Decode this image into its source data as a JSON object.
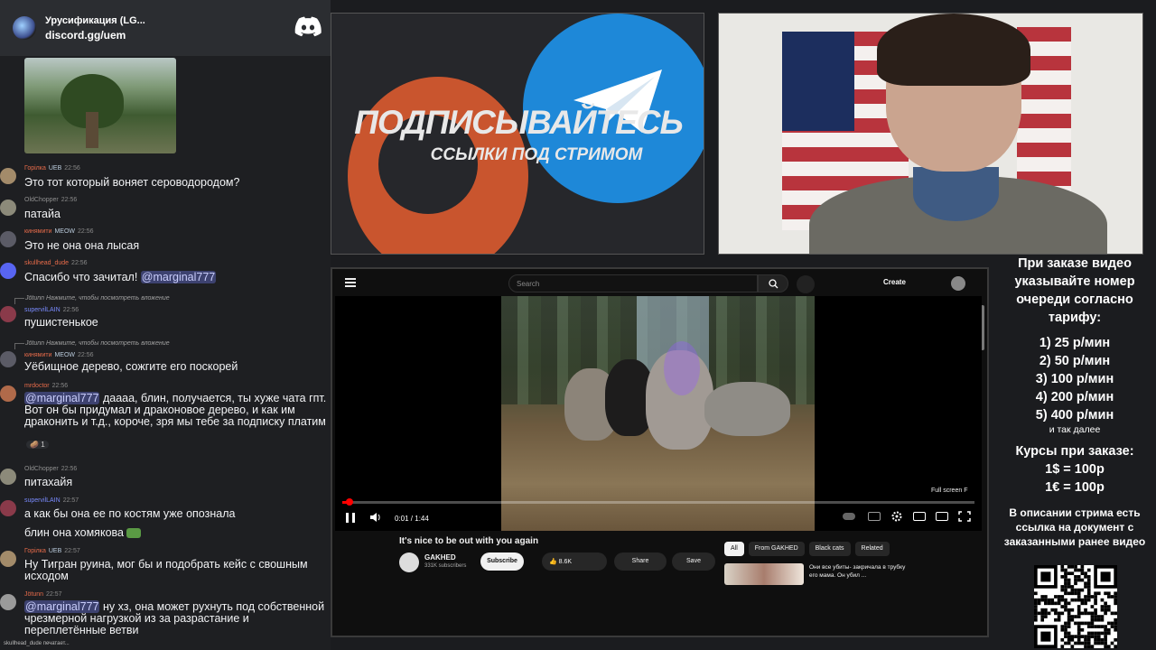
{
  "chat": {
    "server_name": "Урусификация (LG...",
    "server_link": "discord.gg/uem",
    "messages": [
      {
        "user": "Горілка",
        "tag": "UEB",
        "time": "22:56",
        "text": "Это тот который воняет сероводородом?"
      },
      {
        "user": "OldChopper",
        "time": "22:56",
        "text": "патайа"
      },
      {
        "user": "кинямити",
        "tag": "MEOW",
        "time": "22:56",
        "text": "Это не она она лысая"
      },
      {
        "user": "skullhead_dude",
        "time": "22:56",
        "text": "Спасибо что зачитал! ",
        "mention": "@marginal777"
      },
      {
        "reply": "Jötunn Нажмите, чтобы посмотреть вложение",
        "user": "supervilLAIN",
        "time": "22:56",
        "text": "пушистенькое"
      },
      {
        "reply": "Jötunn Нажмите, чтобы посмотреть вложение",
        "user": "кинямити",
        "tag": "MEOW",
        "time": "22:56",
        "text": "Уёбищное дерево, сожгите его поскорей"
      },
      {
        "user": "mrdoctor",
        "time": "22:56",
        "mention": "@marginal777",
        "text": " даааа, блин, получается, ты хуже чата гпт. Вот он бы придумал и драконовое дерево, и как им драконить и т.д., короче, зря мы тебе за подписку платим",
        "reaction": "1"
      },
      {
        "user": "OldChopper",
        "time": "22:56",
        "text": "питахайя"
      },
      {
        "user": "supervilLAIN",
        "time": "22:57",
        "text": "а как бы она ее по костям уже опознала"
      },
      {
        "text": "блин она хомякова"
      },
      {
        "user": "Горілка",
        "tag": "UEB",
        "time": "22:57",
        "text": "Ну Тигран руина, мог бы и подобрать кейс с свошным исходом"
      },
      {
        "user": "Jötunn",
        "time": "22:57",
        "mention": "@marginal777",
        "text": " ну хз, она может рухнуть под собственной чрезмерной нагрузкой из за разрастание и переплетённые ветви"
      }
    ],
    "typing": "skullhead_dude печатает..."
  },
  "promo": {
    "title": "ПОДПИСЫВАЙТЕСЬ",
    "subtitle": "ССЫЛКИ ПОД СТРИМОМ"
  },
  "youtube": {
    "search_placeholder": "Search",
    "create_label": "Create",
    "fullscreen_label": "Full screen",
    "fullscreen_key": "F",
    "time": "0:01 / 1:44",
    "progress": 0.01,
    "video_title": "It's nice to be out with you again",
    "channel": "GAKHED",
    "subscribers": "331K subscribers",
    "subscribe_label": "Subscribe",
    "likes": "8.6K",
    "share_label": "Share",
    "save_label": "Save",
    "chips": [
      "All",
      "From GAKHED",
      "Black cats",
      "Related"
    ],
    "rec_title": "Они все убиты- закричала в трубку его мама. Он убил ..."
  },
  "side": {
    "header": "При заказе видео указывайте номер очереди согласно тарифу:",
    "prices": [
      "1) 25 р/мин",
      "2) 50 р/мин",
      "3) 100 р/мин",
      "4) 200 р/мин",
      "5) 400 р/мин"
    ],
    "etc": "и так далее",
    "rates_title": "Курсы при заказе:",
    "rates": [
      "1$ = 100р",
      "1€ = 100р"
    ],
    "note": "В описании стрима есть ссылка на документ с заказанными ранее видео"
  }
}
